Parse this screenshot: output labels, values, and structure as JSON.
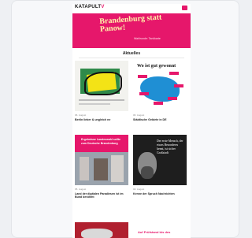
{
  "site": {
    "logo_main": "KATAPULT",
    "logo_accent": "V"
  },
  "hero": {
    "title": "Brandenburg statt Panow!",
    "subtitle": "Wahlrunde: Tankkarte"
  },
  "section": {
    "title": "Aktuelles"
  },
  "cards": [
    {
      "meta": "06. August",
      "title": "Berlin lieber & ungleich ne"
    },
    {
      "meta": "06. August",
      "title": "Städtische Gebiete in DE"
    },
    {
      "meta": "05. August",
      "title": "Land der digitalen Paradiesen ist im Bund berühmt"
    },
    {
      "meta": "04. August",
      "title": "Kenne der Spruch Nachrichten"
    },
    {
      "meta": "",
      "title": ""
    },
    {
      "meta": "",
      "title": ""
    }
  ],
  "thumbs": {
    "t2_label": "Wo ist gut gewonnt",
    "t3_text": "Ergebnisse Landeswahl sollte zum Deutsche Brandenburg",
    "t4_text": "Der erste Mensch, der etwas Besonderes kennt, ist sicher Großstadt",
    "t6_text": "Auf Prüfstand bis des"
  },
  "colors": {
    "brand": "#e6176b",
    "hero_text": "#fff7a8"
  }
}
